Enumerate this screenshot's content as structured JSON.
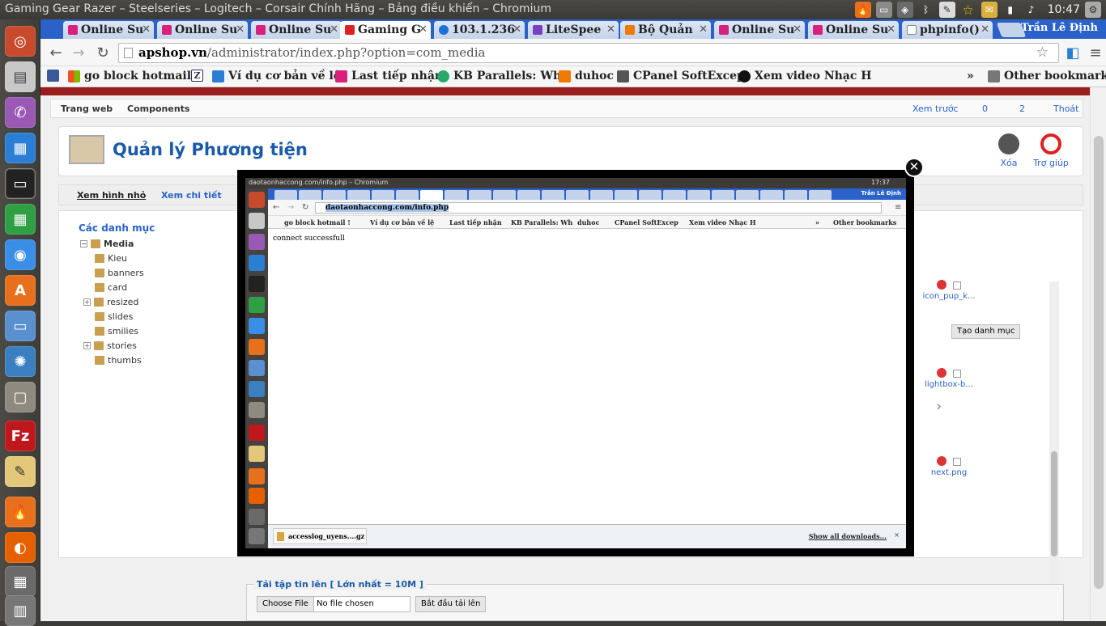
{
  "window_title": "Gaming Gear Razer – Steelseries – Logitech – Corsair Chính Hãng – Bảng điều khiển – Chromium",
  "tray": {
    "clock": "10:47",
    "user": "Trần Lê Định"
  },
  "tabs": [
    {
      "label": "Online Su",
      "color": "#d9207a"
    },
    {
      "label": "Online Su",
      "color": "#d9207a"
    },
    {
      "label": "Online Su",
      "color": "#d9207a"
    },
    {
      "label": "Gaming G",
      "color": "#d22",
      "active": true
    },
    {
      "label": "103.1.236",
      "color": "#1e6fd9"
    },
    {
      "label": "LiteSpee",
      "color": "#7a3fbf"
    },
    {
      "label": "Bộ Quản",
      "color": "#f07a00"
    },
    {
      "label": "Online Su",
      "color": "#d9207a"
    },
    {
      "label": "Online Su",
      "color": "#d9207a"
    },
    {
      "label": "phpinfo()",
      "color": "#888"
    }
  ],
  "tab_user": "Trần Lê Định",
  "url": {
    "host": "apshop.vn",
    "path": "/administrator/index.php?option=com_media"
  },
  "bookmarks": [
    {
      "label": "",
      "color": "#3b5998"
    },
    {
      "label": "go block hotmail !",
      "color": "#f25022"
    },
    {
      "label": "",
      "color": "#3355aa"
    },
    {
      "label": "Ví dụ cơ bản về lệ",
      "color": "#2a7fd4"
    },
    {
      "label": "Last tiếp nhận",
      "color": "#d9207a"
    },
    {
      "label": "KB Parallels: Wh",
      "color": "#2aa86a"
    },
    {
      "label": "duhoc",
      "color": "#f07a00"
    },
    {
      "label": "CPanel SoftExcep",
      "color": "#555"
    },
    {
      "label": "Xem video Nhạc H",
      "color": "#111"
    }
  ],
  "bookmarks_more": "»",
  "other_bookmarks": "Other bookmarks",
  "admin": {
    "menu_left": [
      "Trang web",
      "Components"
    ],
    "menu_right": [
      "Xem trước",
      "0",
      "2",
      "Thoát"
    ],
    "page_title": "Quản lý Phương tiện",
    "btn_delete": "Xóa",
    "btn_help": "Trợ giúp",
    "view_tabs": [
      "Xem hình nhỏ",
      "Xem chi tiết"
    ],
    "categories_label": "Các danh mục",
    "tree": [
      {
        "label": "Media",
        "root": true
      },
      {
        "label": "Kieu"
      },
      {
        "label": "banners"
      },
      {
        "label": "card"
      },
      {
        "label": "resized",
        "expand": true
      },
      {
        "label": "slides"
      },
      {
        "label": "smilies"
      },
      {
        "label": "stories",
        "expand": true
      },
      {
        "label": "thumbs"
      }
    ],
    "create_folder": "Tạo danh mục",
    "files": [
      "icon_pup_k...",
      "lightbox-b...",
      "next.png"
    ],
    "upload_legend": "Tải tập tin lên [ Lớn nhất = 10M ]",
    "choose_file": "Choose File",
    "no_file": "No file chosen",
    "start_upload": "Bắt đầu tải lên"
  },
  "overlay": {
    "close": "✕",
    "title": "daotaonhaccong.com/info.php – Chromium",
    "clock": "17:37",
    "user": "Trần Lê Định",
    "url": "daotaonhaccong.com/info.php",
    "bookmarks": [
      "go block hotmail !",
      "Ví dụ cơ bản về lệ",
      "Last tiếp nhận",
      "KB Parallels: Wh",
      "duhoc",
      "CPanel SoftExcep",
      "Xem video Nhạc H",
      "Other bookmarks"
    ],
    "bookmarks_more": "»",
    "body_text": "connect successfull",
    "download_file": "accesslog_uyens....gz",
    "show_all": "Show all downloads...",
    "close_bar": "×"
  }
}
